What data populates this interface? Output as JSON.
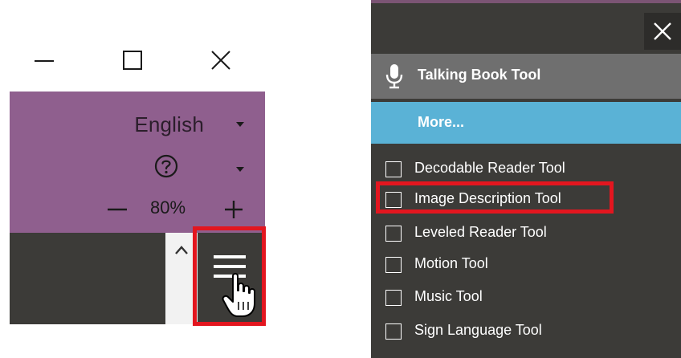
{
  "left_panel": {
    "window_controls": [
      "minimize",
      "maximize",
      "close"
    ],
    "language": {
      "label": "English"
    },
    "help_icon": "help-circle-icon",
    "zoom": {
      "minus": "−",
      "value": "80%",
      "plus": "+"
    },
    "menu_icon": "hamburger-icon",
    "highlight_color": "#e3161f",
    "purple_bar_color": "#8f5f8e"
  },
  "right_panel": {
    "header": {
      "icon": "microphone-icon",
      "label": "Talking Book Tool"
    },
    "more": {
      "label": "More..."
    },
    "tools": [
      {
        "label": "Decodable Reader Tool",
        "checked": false
      },
      {
        "label": "Image Description Tool",
        "checked": false,
        "highlighted": true
      },
      {
        "label": "Leveled Reader Tool",
        "checked": false
      },
      {
        "label": "Motion Tool",
        "checked": false
      },
      {
        "label": "Music Tool",
        "checked": false
      },
      {
        "label": "Sign Language Tool",
        "checked": false
      }
    ],
    "colors": {
      "background": "#3c3b38",
      "header": "#6f6f6f",
      "more": "#5ab2d6"
    }
  }
}
